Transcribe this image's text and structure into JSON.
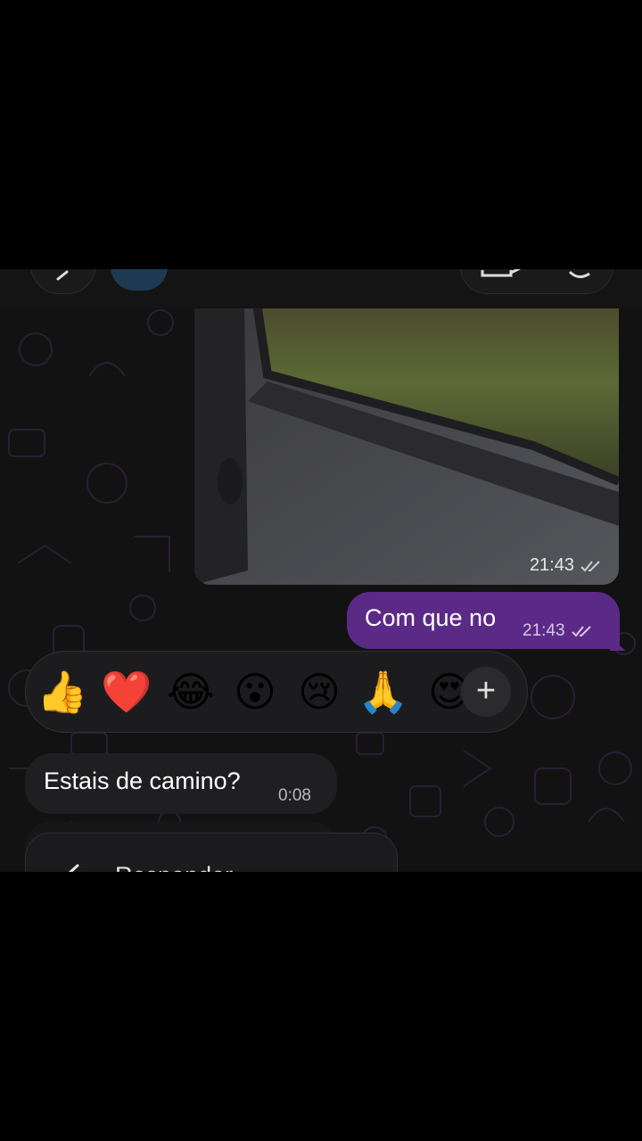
{
  "header": {
    "back_icon": "chevron-left-icon",
    "call_icons": [
      "video-call-icon",
      "phone-call-icon"
    ]
  },
  "messages": {
    "photo": {
      "time": "21:43",
      "status_icon": "double-check-icon"
    },
    "outgoing": {
      "text": "Com que no",
      "time": "21:43",
      "status_icon": "double-check-icon"
    },
    "incoming": {
      "text": "Estais de camino?",
      "time": "0:08"
    }
  },
  "reactions": {
    "items": [
      {
        "emoji": "👍",
        "name": "thumbs-up"
      },
      {
        "emoji": "❤️",
        "name": "red-heart"
      },
      {
        "emoji": "😂",
        "name": "tears-of-joy"
      },
      {
        "emoji": "😮",
        "name": "open-mouth"
      },
      {
        "emoji": "😢",
        "name": "crying-face"
      },
      {
        "emoji": "🙏",
        "name": "folded-hands"
      },
      {
        "emoji": "😍",
        "name": "heart-eyes"
      }
    ],
    "more_label": "+"
  },
  "context_menu": {
    "reply_label": "Responder"
  },
  "colors": {
    "outgoing_bubble": "#5b2a86",
    "incoming_bubble": "#1f1f21",
    "reaction_bar": "#1c1c1e",
    "background": "#121212"
  }
}
